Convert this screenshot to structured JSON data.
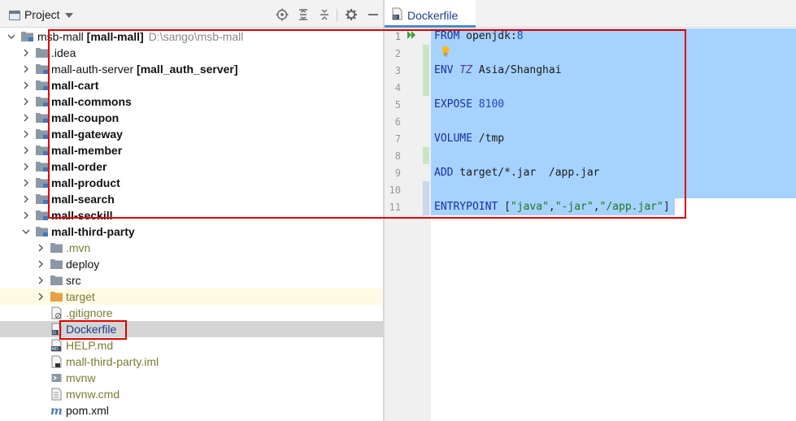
{
  "project_panel": {
    "title": "Project",
    "tree": [
      {
        "label": "msb-mall",
        "module": "[mall-mall]",
        "path": "D:\\sango\\msb-mall",
        "style": "normal",
        "expanded": true
      },
      {
        "label": ".idea",
        "style": "normal",
        "expanded": false
      },
      {
        "label": "mall-auth-server",
        "module": "[mall_auth_server]",
        "style": "normal",
        "expanded": false
      },
      {
        "label": "mall-cart",
        "style": "bold",
        "expanded": false
      },
      {
        "label": "mall-commons",
        "style": "bold",
        "expanded": false
      },
      {
        "label": "mall-coupon",
        "style": "bold",
        "expanded": false
      },
      {
        "label": "mall-gateway",
        "style": "bold",
        "expanded": false
      },
      {
        "label": "mall-member",
        "style": "bold",
        "expanded": false
      },
      {
        "label": "mall-order",
        "style": "bold",
        "expanded": false
      },
      {
        "label": "mall-product",
        "style": "bold",
        "expanded": false
      },
      {
        "label": "mall-search",
        "style": "bold",
        "expanded": false
      },
      {
        "label": "mall-seckill",
        "style": "bold",
        "expanded": false
      },
      {
        "label": "mall-third-party",
        "style": "bold",
        "expanded": true
      },
      {
        "label": ".mvn",
        "style": "olive",
        "expanded": false
      },
      {
        "label": "deploy",
        "style": "normal",
        "expanded": false
      },
      {
        "label": "src",
        "style": "normal",
        "expanded": false
      },
      {
        "label": "target",
        "style": "olive",
        "expanded": false
      },
      {
        "label": ".gitignore",
        "style": "olive"
      },
      {
        "label": "Dockerfile",
        "style": "navy"
      },
      {
        "label": "HELP.md",
        "style": "olive"
      },
      {
        "label": "mall-third-party.iml",
        "style": "olive"
      },
      {
        "label": "mvnw",
        "style": "olive"
      },
      {
        "label": "mvnw.cmd",
        "style": "olive"
      },
      {
        "label": "pom.xml",
        "style": "normal"
      }
    ]
  },
  "editor": {
    "tab_label": "Dockerfile",
    "line_numbers": [
      "1",
      "2",
      "3",
      "4",
      "5",
      "6",
      "7",
      "8",
      "9",
      "10",
      "11"
    ],
    "lines": [
      {
        "kw": "FROM",
        "rest": " openjdk:",
        "num": "8"
      },
      {},
      {
        "kw": "ENV",
        "var": "TZ",
        "rest": " Asia/Shanghai"
      },
      {},
      {
        "kw": "EXPOSE",
        "num": "8100"
      },
      {},
      {
        "kw": "VOLUME",
        "rest": " /tmp"
      },
      {},
      {
        "kw": "ADD",
        "rest": " target/*.jar  /app.jar"
      },
      {},
      {
        "kw": "ENTRYPOINT",
        "pre": " [",
        "s1": "\"java\"",
        "c1": ",",
        "s2": "\"-jar\"",
        "c2": ",",
        "s3": "\"/app.jar\"",
        "post": "]"
      }
    ]
  },
  "colors": {
    "selection": "#a6d2ff",
    "highlight_box": "#e00000",
    "keyword": "#1b2f9e",
    "string": "#1a7a1a",
    "number": "#1f45c7"
  }
}
